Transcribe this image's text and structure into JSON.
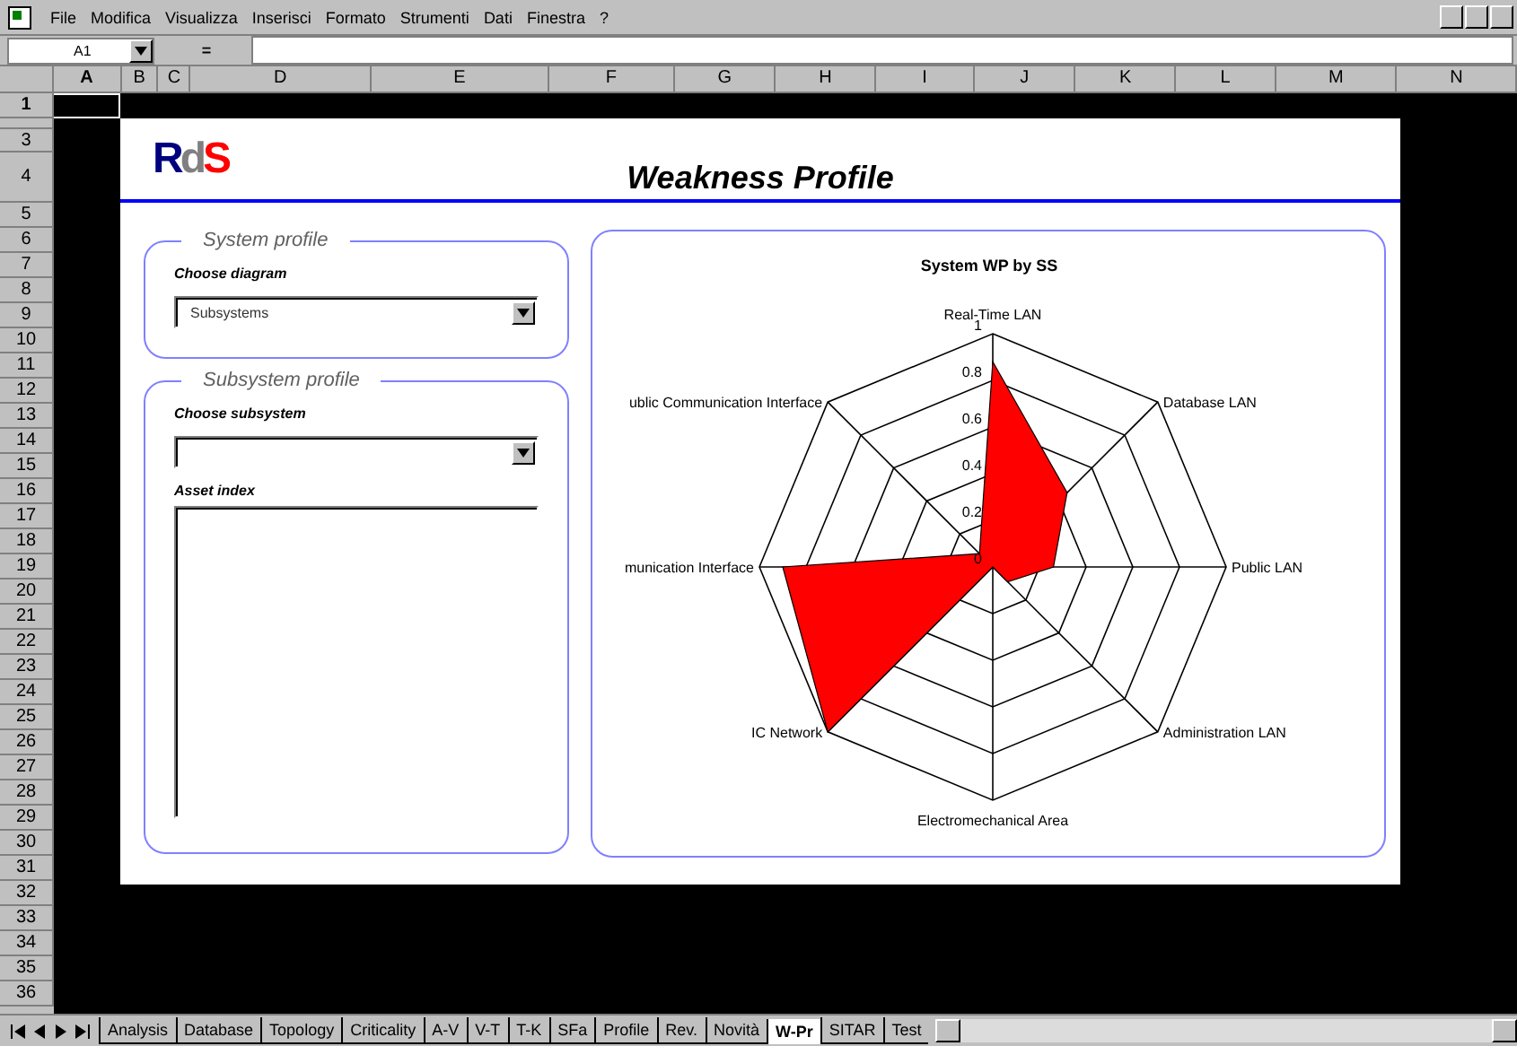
{
  "menu": [
    "File",
    "Modifica",
    "Visualizza",
    "Inserisci",
    "Formato",
    "Strumenti",
    "Dati",
    "Finestra",
    "?"
  ],
  "formula_bar": {
    "name_box": "A1",
    "equals": "="
  },
  "columns": [
    "A",
    "B",
    "C",
    "D",
    "E",
    "F",
    "G",
    "H",
    "I",
    "J",
    "K",
    "L",
    "M",
    "N"
  ],
  "rows": [
    "1",
    "3",
    "4",
    "5",
    "6",
    "7",
    "8",
    "9",
    "10",
    "11",
    "12",
    "13",
    "14",
    "15",
    "16",
    "17",
    "18",
    "19",
    "20",
    "21",
    "22",
    "23",
    "24",
    "25",
    "26",
    "27",
    "28",
    "29",
    "30",
    "31",
    "32",
    "33",
    "34",
    "35",
    "36"
  ],
  "sheet": {
    "logo": [
      "R",
      "d",
      "S"
    ],
    "title": "Weakness Profile",
    "system_profile": {
      "legend": "System profile",
      "label": "Choose diagram",
      "value": "Subsystems"
    },
    "subsystem_profile": {
      "legend": "Subsystem profile",
      "label": "Choose subsystem",
      "list_label": "Asset index"
    },
    "chart_data": {
      "type": "radar",
      "title": "System WP by SS",
      "categories": [
        "Real-Time LAN",
        "Database LAN",
        "Public LAN",
        "Administration LAN",
        "Electromechanical Area",
        "IC Network",
        "munication Interface",
        "ublic Communication Interface"
      ],
      "series": [
        {
          "color": "#ff0000",
          "values": [
            0.88,
            0.45,
            0.26,
            0.09,
            0,
            1,
            0.9,
            0.08
          ]
        }
      ],
      "ylim": [
        0,
        1
      ],
      "yticks": [
        0,
        0.2,
        0.4,
        0.6,
        0.8,
        1
      ]
    }
  },
  "sheet_tabs": [
    {
      "label": "Analysis",
      "selected": false
    },
    {
      "label": "Database",
      "selected": false
    },
    {
      "label": "Topology",
      "selected": false
    },
    {
      "label": "Criticality",
      "selected": false
    },
    {
      "label": "A-V",
      "selected": false
    },
    {
      "label": "V-T",
      "selected": false
    },
    {
      "label": "T-K",
      "selected": false
    },
    {
      "label": "SFa",
      "selected": false
    },
    {
      "label": "Profile",
      "selected": false
    },
    {
      "label": "Rev.",
      "selected": false
    },
    {
      "label": "Novità",
      "selected": false
    },
    {
      "label": "W-Pr",
      "selected": true
    },
    {
      "label": "SITAR",
      "selected": false
    },
    {
      "label": "Test",
      "selected": false
    }
  ]
}
